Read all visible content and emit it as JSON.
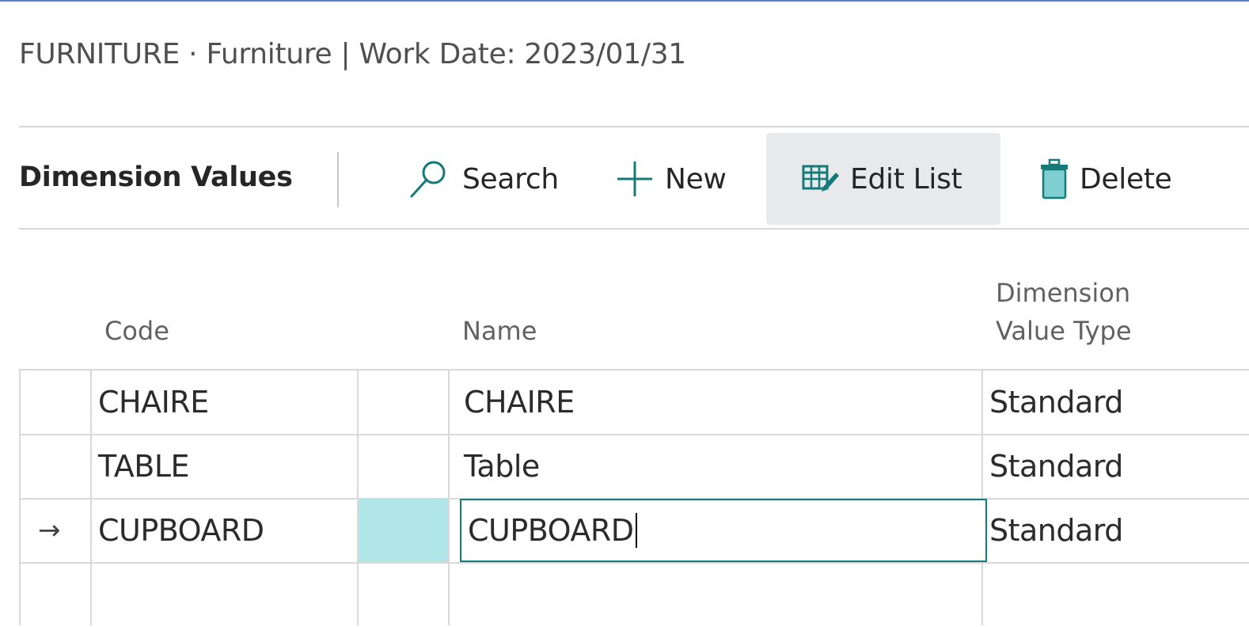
{
  "context_bar": {
    "text": "FURNITURE · Furniture | Work Date: 2023/01/31"
  },
  "page": {
    "title": "Dimension Values"
  },
  "actions": {
    "search": "Search",
    "new": "New",
    "edit_list": "Edit List",
    "delete": "Delete"
  },
  "icons": {
    "search": "search-icon",
    "new": "plus-icon",
    "edit_list": "edit-list-icon",
    "delete": "trash-icon"
  },
  "columns": {
    "code": "Code",
    "name": "Name",
    "dimension_value_type_line1": "Dimension",
    "dimension_value_type_line2": "Value Type"
  },
  "rows": [
    {
      "marker": "",
      "code": "CHAIRE",
      "name": "CHAIRE",
      "type": "Standard"
    },
    {
      "marker": "",
      "code": "TABLE",
      "name": "Table",
      "type": "Standard"
    },
    {
      "marker": "→",
      "code": "CUPBOARD",
      "name": "CUPBOARD",
      "type": "Standard"
    }
  ],
  "colors": {
    "accent": "#157a7a",
    "selected_cell": "#b1e6e8",
    "edit_list_bg": "#e8e9ea",
    "top_border": "#5a7ec7"
  }
}
